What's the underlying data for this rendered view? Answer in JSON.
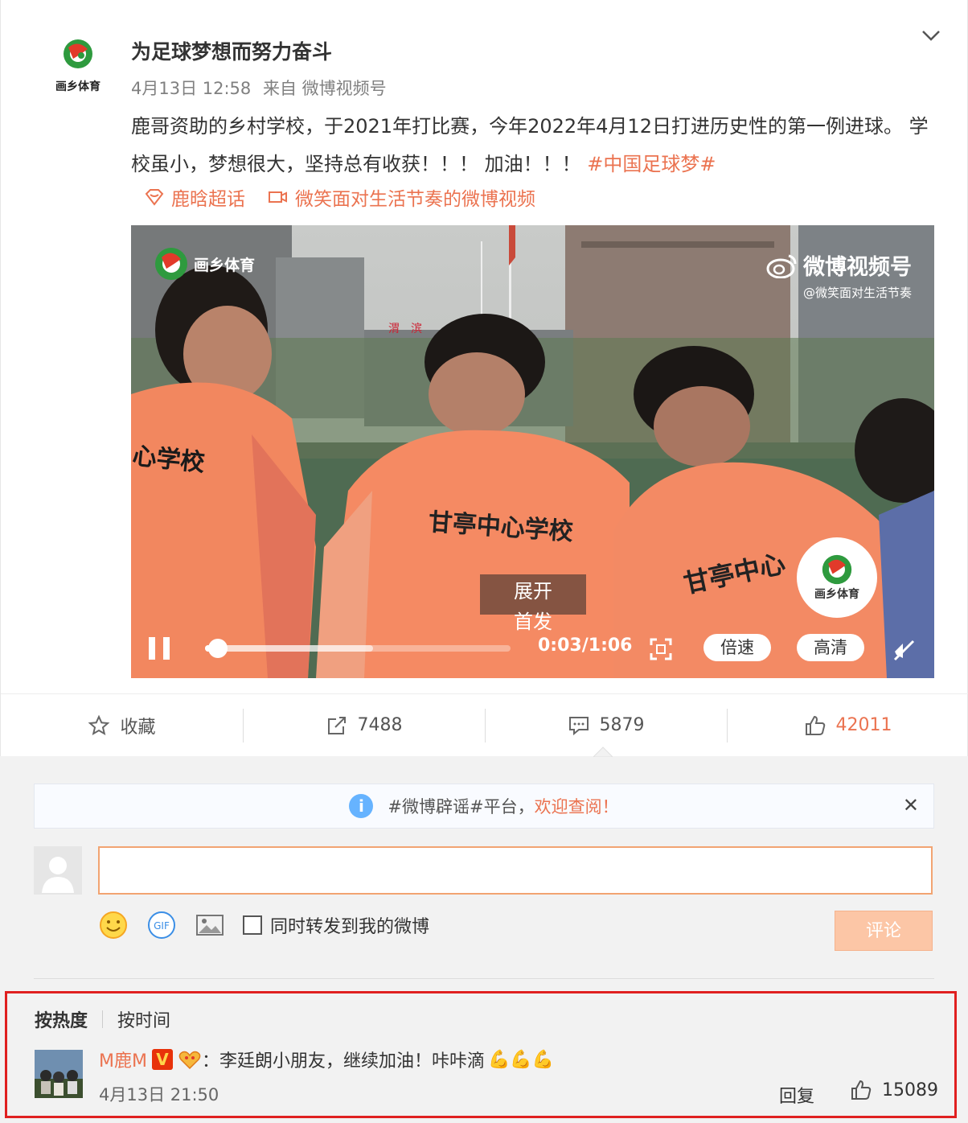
{
  "post": {
    "author": "为足球梦想而努力奋斗",
    "date": "4月13日 12:58",
    "source": "来自 微博视频号",
    "text": "鹿哥资助的乡村学校，于2021年打比赛，今年2022年4月12日打进历史性的第一例进球。 学校虽小，梦想很大，坚持总有收获！！！ 加油！！！",
    "hashtag": "#中国足球梦#",
    "tags": [
      {
        "icon": "supertopic-icon",
        "label": "鹿晗超话"
      },
      {
        "icon": "video-tag-icon",
        "label": "微笑面对生活节奏的微博视频"
      }
    ],
    "logo_caption": "画乡体育"
  },
  "video": {
    "watermark_title": "微博视频号",
    "watermark_sub": "@微笑面对生活节奏",
    "logo_text": "画乡体育",
    "jersey_text": "甘亭中心学校",
    "jersey_text_left": "心学校",
    "jersey_text_right": "甘亭中心",
    "sign_text": "渭滨",
    "expand_label": "展开",
    "first_publish": "首发",
    "current_time": "0:03",
    "duration": "1:06",
    "timecode": "0:03/1:06",
    "played_fraction": 0.02,
    "buffered_fraction": 0.55,
    "speed_label": "倍速",
    "quality_label": "高清"
  },
  "actions": {
    "favorite": "收藏",
    "repost_count": "7488",
    "comment_count": "5879",
    "like_count": "42011"
  },
  "notice": {
    "text": "#微博辟谣#平台，",
    "link": "欢迎查阅！",
    "close": "✕"
  },
  "composer": {
    "placeholder": "",
    "forward_label": "同时转发到我的微博",
    "submit_label": "评论"
  },
  "comments": {
    "sort_hot": "按热度",
    "sort_time": "按时间",
    "items": [
      {
        "user": "M鹿M",
        "text": "：李廷朗小朋友，继续加油！咔咔滴",
        "emoji": "💪💪💪",
        "time": "4月13日 21:50",
        "reply": "回复",
        "likes": "15089"
      }
    ]
  },
  "colors": {
    "accent": "#eb7350",
    "jersey": "#f5896a",
    "submit_disabled": "#fcc6a6",
    "highlight_border": "#e02020"
  }
}
